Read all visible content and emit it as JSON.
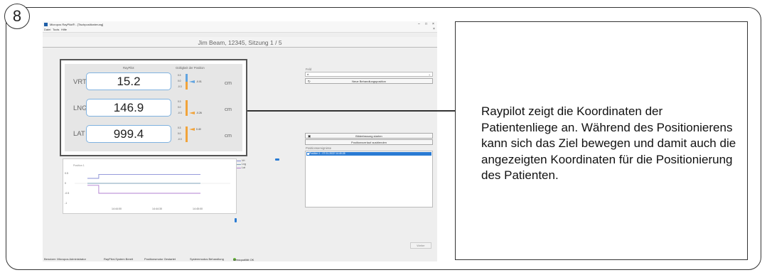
{
  "step_number": "8",
  "app": {
    "title": "Micropos RayPilot® - [Tischpositionierung]",
    "window_controls": {
      "minimize": "–",
      "maximize": "□",
      "close": "×",
      "inner_close": "×"
    },
    "menu": [
      "Datei",
      "Tools",
      "Hilfe"
    ],
    "patient_title": "Jim Beam, 12345, Sitzung 1 / 5"
  },
  "coords": {
    "col_raypilot": "RayPilot",
    "col_validity": "Gültigkeit der Position",
    "rows": [
      {
        "axis": "VRT",
        "value": "15.2",
        "unit": "cm",
        "offset": "-0.01",
        "ticks": [
          "0.3",
          "0.0",
          "-0.3"
        ],
        "indicator_color": "#62a4e0"
      },
      {
        "axis": "LNG",
        "value": "146.9",
        "unit": "cm",
        "offset": "-0.26",
        "ticks": [
          "0.3",
          "0.0",
          "-0.3"
        ],
        "indicator_color": "#f1a33a"
      },
      {
        "axis": "LAT",
        "value": "999.4",
        "unit": "cm",
        "offset": "0.40",
        "ticks": [
          "0.3",
          "0.0",
          "-0.3"
        ],
        "indicator_color": "#f1a33a"
      }
    ]
  },
  "right_panel": {
    "field_label": "Feld",
    "field_value": "rt",
    "new_position_button": "Neue Behandlungsposition",
    "image_button": "Bilderfassung starten",
    "history_button": "Positionsverlauf ausblenden",
    "events_label": "Positionsereignisse",
    "events": [
      "Position 1 - 07.01.2022 14:45:28"
    ]
  },
  "chart_data": {
    "type": "line",
    "title": "Position 1",
    "y_ticks": [
      "0.5",
      "0",
      "-0.5",
      "-1"
    ],
    "x_ticks": [
      "14:44:00",
      "14:44:30",
      "14:45:00"
    ],
    "ylim": [
      -1,
      1
    ],
    "series": [
      {
        "name": "Vrt",
        "color": "#8a8fd6",
        "x": [
          0,
          0.1,
          0.1,
          1
        ],
        "values": [
          0.25,
          0.25,
          0.45,
          0.45
        ]
      },
      {
        "name": "Lng",
        "color": "#7fa3b8",
        "x": [
          0,
          0.1,
          0.1,
          1
        ],
        "values": [
          0.0,
          0.0,
          0.0,
          0.0
        ]
      },
      {
        "name": "Lat",
        "color": "#b07fd0",
        "x": [
          0,
          0.1,
          0.1,
          1
        ],
        "values": [
          -0.1,
          -0.1,
          -0.5,
          -0.5
        ]
      }
    ],
    "legend": "top-right"
  },
  "weiter_button": "Weiter",
  "status_bar": {
    "user": "Benutzer: Micropos Administrator",
    "system": "RayPilot-System Bereit",
    "motor": "Positionsmotor Gestartet",
    "mode": "Systemmodus Behandlung",
    "quality": "Messqualität OK"
  },
  "callout_text": " Raypilot zeigt die Koordinaten der Patientenliege an. Während des Positionierens kann sich das Ziel bewegen und damit auch die angezeigten Koordinaten für die Positionierung des Patienten."
}
